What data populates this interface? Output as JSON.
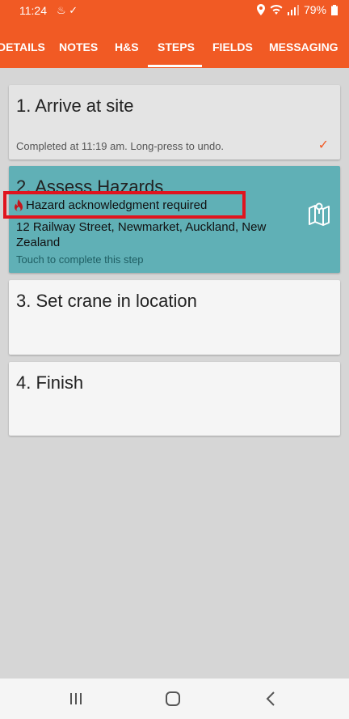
{
  "status_bar": {
    "time": "11:24",
    "battery": "79%"
  },
  "tabs": [
    {
      "label": "DETAILS"
    },
    {
      "label": "NOTES"
    },
    {
      "label": "H&S"
    },
    {
      "label": "STEPS",
      "active": true
    },
    {
      "label": "FIELDS"
    },
    {
      "label": "MESSAGING"
    }
  ],
  "steps": [
    {
      "title": "1. Arrive at site",
      "note": "Completed at 11:19 am. Long-press to undo."
    },
    {
      "title": "2. Assess Hazards",
      "hazard": "Hazard acknowledgment required",
      "address": "12 Railway Street, Newmarket, Auckland, New Zealand",
      "note": "Touch to complete this step"
    },
    {
      "title": "3. Set crane in location"
    },
    {
      "title": "4. Finish"
    }
  ],
  "colors": {
    "primary": "#f15a24",
    "active_step": "#60b0b6",
    "highlight_box": "#e0141e"
  }
}
